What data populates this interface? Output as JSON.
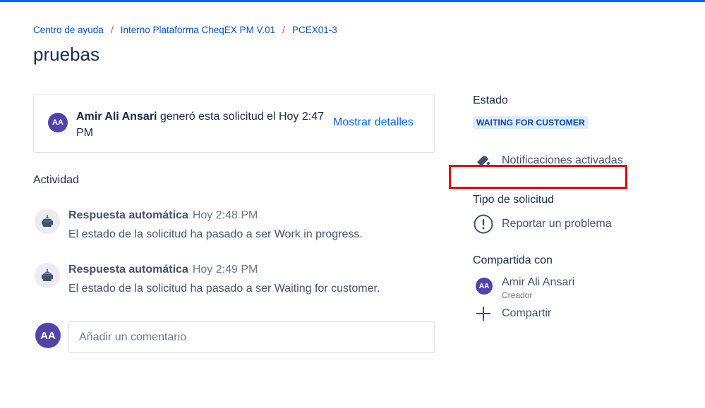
{
  "breadcrumb": {
    "items": [
      "Centro de ayuda",
      "Interno Plataforma CheqEX PM V.01",
      "PCEX01-3"
    ],
    "separator": "/"
  },
  "page_title": "pruebas",
  "request": {
    "avatar_initials": "AA",
    "author": "Amir Ali Ansari",
    "description": " generó esta solicitud el Hoy 2:47 PM",
    "show_details_label": "Mostrar detalles"
  },
  "activity": {
    "heading": "Actividad",
    "items": [
      {
        "avatar_icon": "robot-icon",
        "author": "Respuesta automática",
        "time": "Hoy 2:48 PM",
        "text": "El estado de la solicitud ha pasado a ser Work in progress."
      },
      {
        "avatar_icon": "robot-icon",
        "author": "Respuesta automática",
        "time": "Hoy 2:49 PM",
        "text": "El estado de la solicitud ha pasado a ser Waiting for customer."
      }
    ]
  },
  "comment": {
    "avatar_initials": "AA",
    "placeholder": "Añadir un comentario"
  },
  "sidebar": {
    "status_label": "Estado",
    "status_value": "WAITING FOR CUSTOMER",
    "notifications_label": "Notificaciones activadas",
    "request_type_label": "Tipo de solicitud",
    "request_type_value": "Reportar un problema",
    "shared_label": "Compartida con",
    "shared_user": {
      "initials": "AA",
      "name": "Amir Ali Ansari",
      "role": "Creador"
    },
    "share_button_label": "Compartir"
  },
  "colors": {
    "accent": "#0065ff",
    "link": "#0052cc",
    "avatar": "#5243aa",
    "status_bg": "#deebff",
    "status_text": "#0747a6",
    "highlight_border": "#e3000b"
  }
}
